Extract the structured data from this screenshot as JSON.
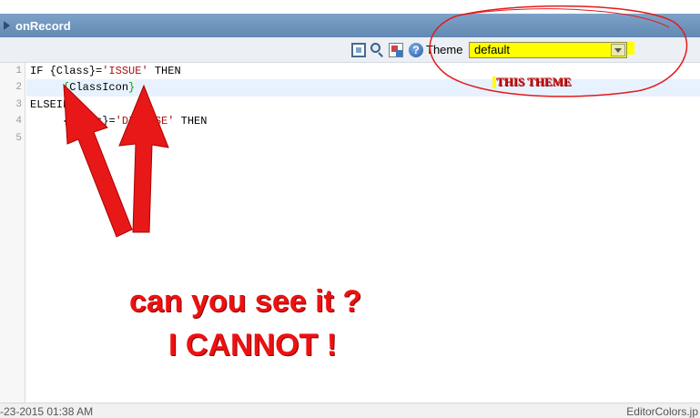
{
  "window": {
    "title": "onRecord"
  },
  "toolbar": {
    "icons": [
      "fullscreen-icon",
      "search-icon",
      "replace-icon",
      "help-icon"
    ],
    "help_glyph": "?",
    "theme_label": "Theme",
    "theme_value": "default"
  },
  "editor": {
    "line_numbers": [
      "1",
      "2",
      "3",
      "4",
      "5"
    ],
    "lines": {
      "l1": {
        "kw1": "IF ",
        "var": "{Class}",
        "op": "=",
        "str": "'ISSUE'",
        "kw2": " THEN"
      },
      "l2": {
        "indent": "     ",
        "open": "{",
        "var": "ClassIcon",
        "close": "}"
      },
      "l3": {
        "text": "ELSEIF"
      },
      "l4": {
        "indent": "     ",
        "var": "{Class}",
        "op": "=",
        "str": "'DISEASE'",
        "kw2": " THEN"
      }
    }
  },
  "status": {
    "left": "-23-2015 01:38 AM",
    "right": "EditorColors.jp"
  },
  "annotations": {
    "theme_note": "THIS THEME",
    "question": "can you see it ?",
    "cannot": "I CANNOT !"
  },
  "colors": {
    "title_bar": "#6a91bb",
    "theme_highlight": "#ffff00",
    "annotation_red": "#ee1111",
    "string_literal": "#aa1111",
    "bracket_green": "#00aa00"
  }
}
